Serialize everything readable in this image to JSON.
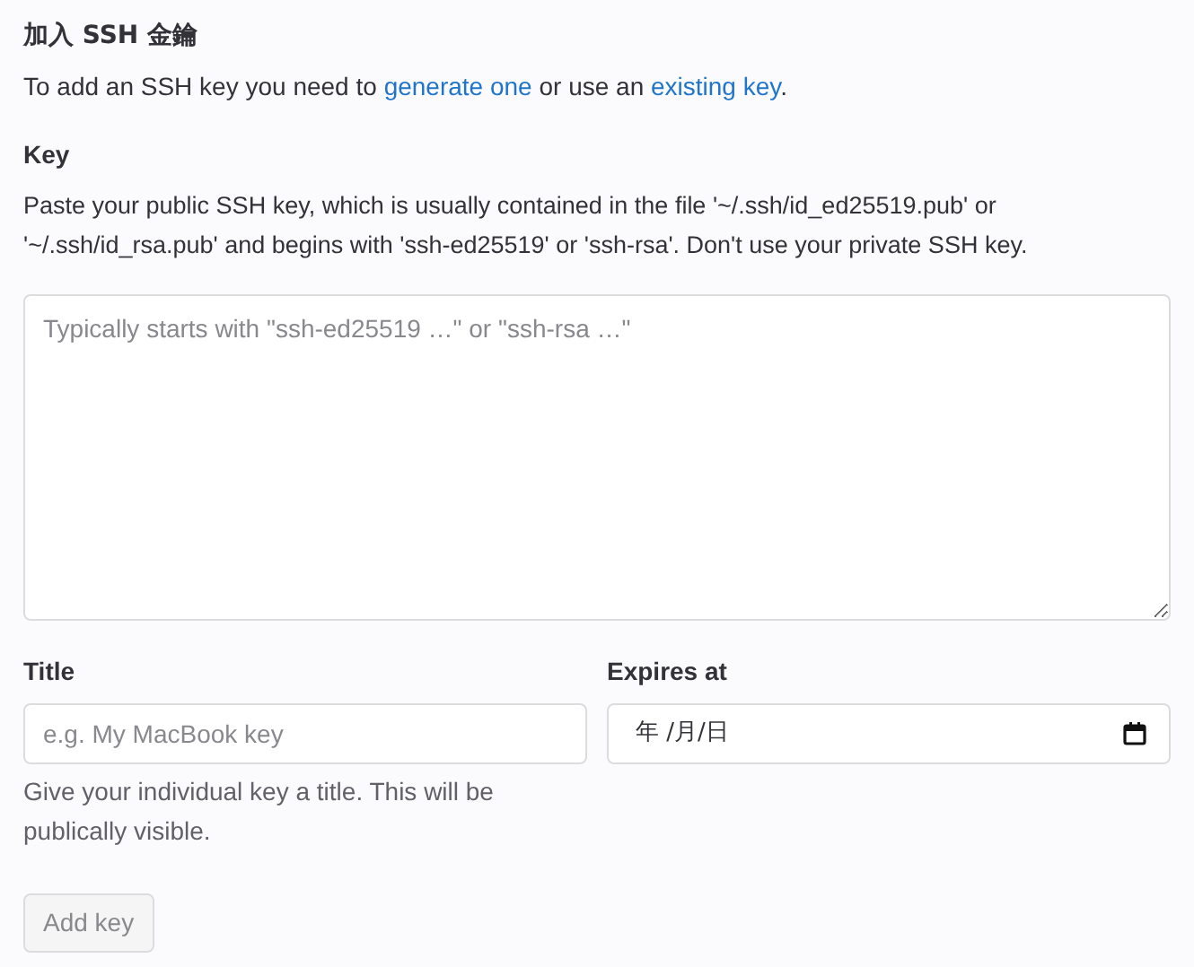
{
  "heading": "加入 SSH 金鑰",
  "intro": [
    {
      "kind": "text",
      "text": "To add an SSH key you need to "
    },
    {
      "kind": "link",
      "text": "generate one"
    },
    {
      "kind": "text",
      "text": " or use an "
    },
    {
      "kind": "link",
      "text": "existing key"
    },
    {
      "kind": "text",
      "text": "."
    }
  ],
  "key": {
    "label": "Key",
    "help": "Paste your public SSH key, which is usually contained in the file '~/.ssh/id_ed25519.pub' or '~/.ssh/id_rsa.pub' and begins with 'ssh-ed25519' or 'ssh-rsa'. Don't use your private SSH key.",
    "placeholder": "Typically starts with \"ssh-ed25519 …\" or \"ssh-rsa …\""
  },
  "title": {
    "label": "Title",
    "placeholder": "e.g. My MacBook key",
    "help": "Give your individual key a title. This will be publically visible."
  },
  "expires": {
    "label": "Expires at",
    "value": "年 /月/日"
  },
  "submit": {
    "label": "Add key",
    "disabled": true
  }
}
